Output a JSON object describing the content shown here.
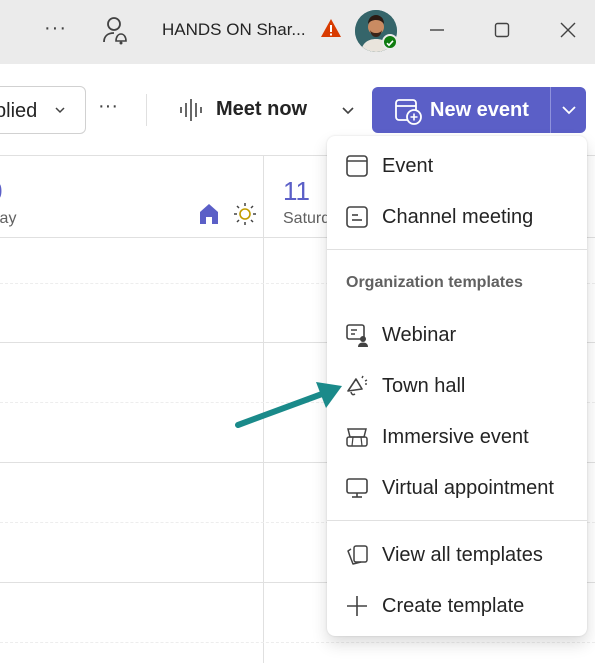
{
  "titlebar": {
    "title": "HANDS ON Shar...",
    "more_label": "···",
    "icons": [
      "more-horizontal-icon",
      "person-notification-icon",
      "warning-icon",
      "avatar",
      "minimize-icon",
      "maximize-icon",
      "close-icon"
    ]
  },
  "toolbar": {
    "filter_label": "plied",
    "more_label": "···",
    "meet_now_label": "Meet now",
    "new_event_label": "New event"
  },
  "calendar": {
    "left_day_number": "0",
    "left_day_name": "lay",
    "right_day_number": "11",
    "right_day_name": "Saturd"
  },
  "menu": {
    "items_top": [
      {
        "label": "Event",
        "icon": "calendar-event-icon"
      },
      {
        "label": "Channel meeting",
        "icon": "channel-meeting-icon"
      }
    ],
    "section_title": "Organization templates",
    "templates": [
      {
        "label": "Webinar",
        "icon": "webinar-icon"
      },
      {
        "label": "Town hall",
        "icon": "megaphone-icon"
      },
      {
        "label": "Immersive event",
        "icon": "immersive-event-icon"
      },
      {
        "label": "Virtual appointment",
        "icon": "virtual-appointment-icon"
      }
    ],
    "items_bottom": [
      {
        "label": "View all templates",
        "icon": "templates-icon"
      },
      {
        "label": "Create template",
        "icon": "plus-icon"
      }
    ]
  },
  "colors": {
    "accent": "#5b5fc7",
    "warning": "#d83b01",
    "presence": "#107c10",
    "arrow": "#1a8a8a"
  }
}
